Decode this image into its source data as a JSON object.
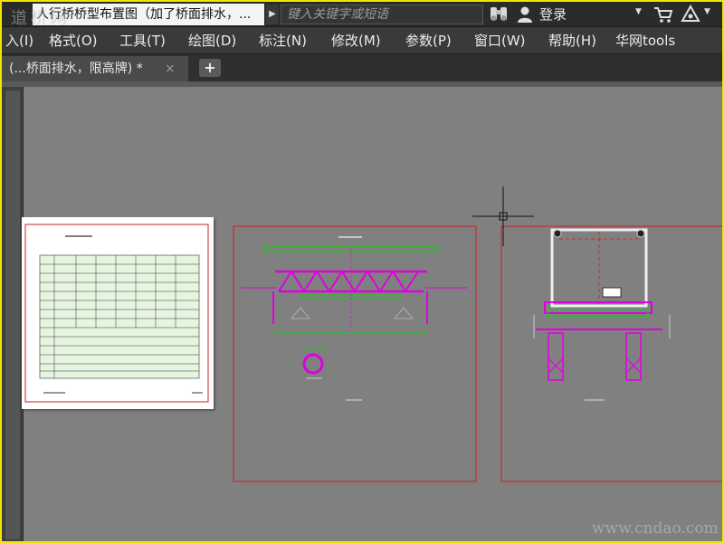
{
  "titlebar": {
    "document_title": "人行桥桥型布置图（加了桥面排水，...",
    "search_placeholder": "键入关键字或短语",
    "login_label": "登录",
    "watermark": "道桥网"
  },
  "menubar": {
    "items": [
      {
        "label": "入(I)"
      },
      {
        "label": "格式(O)"
      },
      {
        "label": "工具(T)"
      },
      {
        "label": "绘图(D)"
      },
      {
        "label": "标注(N)"
      },
      {
        "label": "修改(M)"
      },
      {
        "label": "参数(P)"
      },
      {
        "label": "窗口(W)"
      },
      {
        "label": "帮助(H)"
      },
      {
        "label": "华网tools"
      }
    ]
  },
  "tabs": {
    "active_label": "(...桥面排水，限高牌) *",
    "close_glyph": "×",
    "new_tab_glyph": "+"
  },
  "canvas": {
    "watermark": "www.cndao.com"
  },
  "icons": {
    "search": "binoculars-icon",
    "user": "user-icon",
    "cart": "cart-icon",
    "help": "help-icon"
  },
  "colors": {
    "frame_border": "#f2e600",
    "background": "#808080",
    "drawing_red": "#d01e1e",
    "drawing_magenta": "#e000e0",
    "drawing_green": "#00e000"
  }
}
